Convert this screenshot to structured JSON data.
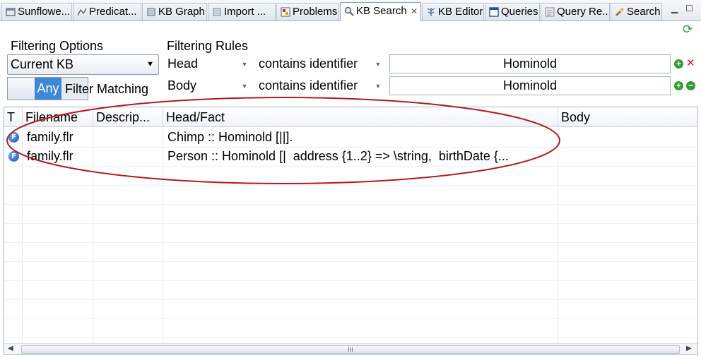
{
  "tabs": [
    {
      "label": "Sunflowe...",
      "icon": "sunflower-icon"
    },
    {
      "label": "Predicat...",
      "icon": "predicate-icon"
    },
    {
      "label": "KB Graph",
      "icon": "graph-icon"
    },
    {
      "label": "Import ...",
      "icon": "import-icon"
    },
    {
      "label": "Problems",
      "icon": "problems-icon"
    },
    {
      "label": "KB Search",
      "icon": "search-icon",
      "active": true
    },
    {
      "label": "KB Editor",
      "icon": "tree-icon"
    },
    {
      "label": "Queries",
      "icon": "queries-icon"
    },
    {
      "label": "Query Re...",
      "icon": "query-results-icon"
    },
    {
      "label": "Search",
      "icon": "flashlight-icon"
    }
  ],
  "filtering_options": {
    "title": "Filtering Options",
    "kb_select": "Current KB",
    "toggle_label": "Any",
    "filter_matching": "Filter Matching"
  },
  "filtering_rules": {
    "title": "Filtering Rules",
    "rules": [
      {
        "field": "Head",
        "operator": "contains identifier",
        "value": "Hominold"
      },
      {
        "field": "Body",
        "operator": "contains identifier",
        "value": "Hominold"
      }
    ]
  },
  "table": {
    "columns": [
      "T",
      "Filename",
      "Descrip...",
      "Head/Fact",
      "Body"
    ],
    "rows": [
      {
        "type_icon": "F",
        "filename": "family.flr",
        "description": "",
        "head": "Chimp :: Hominold [||].",
        "body": ""
      },
      {
        "type_icon": "F",
        "filename": "family.flr",
        "description": "",
        "head": "Person :: Hominold [|  address {1..2} => \\string,  birthDate {...",
        "body": ""
      }
    ]
  },
  "scrollbar_grip": "III",
  "colors": {
    "accent": "#3d87d9",
    "annotation_ellipse": "#b01c1c",
    "add_green": "#2f9e2f",
    "remove_red": "#d11111"
  }
}
